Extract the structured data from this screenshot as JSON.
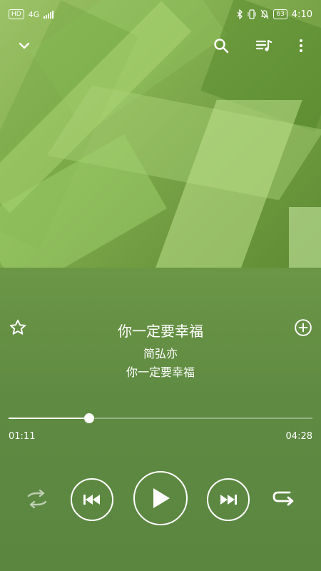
{
  "status_bar": {
    "hd_label": "HD",
    "network_label": "4G",
    "battery_label": "63",
    "time": "4:10"
  },
  "toolbar": {
    "collapse_icon": "chevron-down-icon",
    "search_icon": "search-icon",
    "queue_icon": "playlist-icon",
    "more_icon": "more-vertical-icon"
  },
  "song": {
    "title": "你一定要幸福",
    "artist": "简弘亦",
    "album": "你一定要幸福"
  },
  "progress": {
    "current_time": "01:11",
    "total_time": "04:28",
    "fraction": 0.265
  },
  "controls": {
    "shuffle_icon": "shuffle-icon",
    "prev_icon": "skip-previous-icon",
    "play_icon": "play-icon",
    "next_icon": "skip-next-icon",
    "repeat_icon": "repeat-icon"
  }
}
